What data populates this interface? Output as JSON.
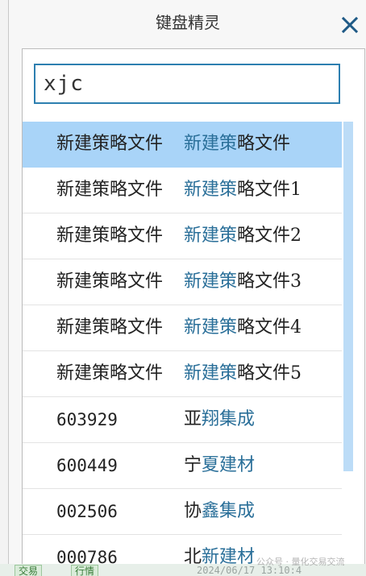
{
  "dialog": {
    "title": "键盘精灵",
    "search": {
      "value": "xjc"
    },
    "items": [
      {
        "code": "新建策略文件",
        "name_hl": "新建策",
        "name_rest": "略文件",
        "selected": true,
        "mono": false
      },
      {
        "code": "新建策略文件",
        "name_hl": "新建策",
        "name_rest": "略文件1",
        "selected": false,
        "mono": false
      },
      {
        "code": "新建策略文件",
        "name_hl": "新建策",
        "name_rest": "略文件2",
        "selected": false,
        "mono": false
      },
      {
        "code": "新建策略文件",
        "name_hl": "新建策",
        "name_rest": "略文件3",
        "selected": false,
        "mono": false
      },
      {
        "code": "新建策略文件",
        "name_hl": "新建策",
        "name_rest": "略文件4",
        "selected": false,
        "mono": false
      },
      {
        "code": "新建策略文件",
        "name_hl": "新建策",
        "name_rest": "略文件5",
        "selected": false,
        "mono": false
      },
      {
        "code": "603929",
        "name_pre": "亚",
        "name_hl": "翔集成",
        "selected": false,
        "mono": true
      },
      {
        "code": "600449",
        "name_pre": "宁",
        "name_hl": "夏建材",
        "selected": false,
        "mono": true
      },
      {
        "code": "002506",
        "name_pre": "协",
        "name_hl": "鑫集成",
        "selected": false,
        "mono": true
      },
      {
        "code": "000786",
        "name_pre": "北",
        "name_hl": "新建材",
        "selected": false,
        "mono": true
      }
    ]
  },
  "background": {
    "tab_1": "交易",
    "tab_2": "行情",
    "timestamp": "2024/06/17 13:10:4"
  },
  "watermark": "公众号 · 量化交易交流",
  "colors": {
    "accent": "#2d7fb0",
    "selection": "#a9d4f8",
    "highlight_text": "#2a6f99",
    "close_icon": "#1f5a86"
  }
}
